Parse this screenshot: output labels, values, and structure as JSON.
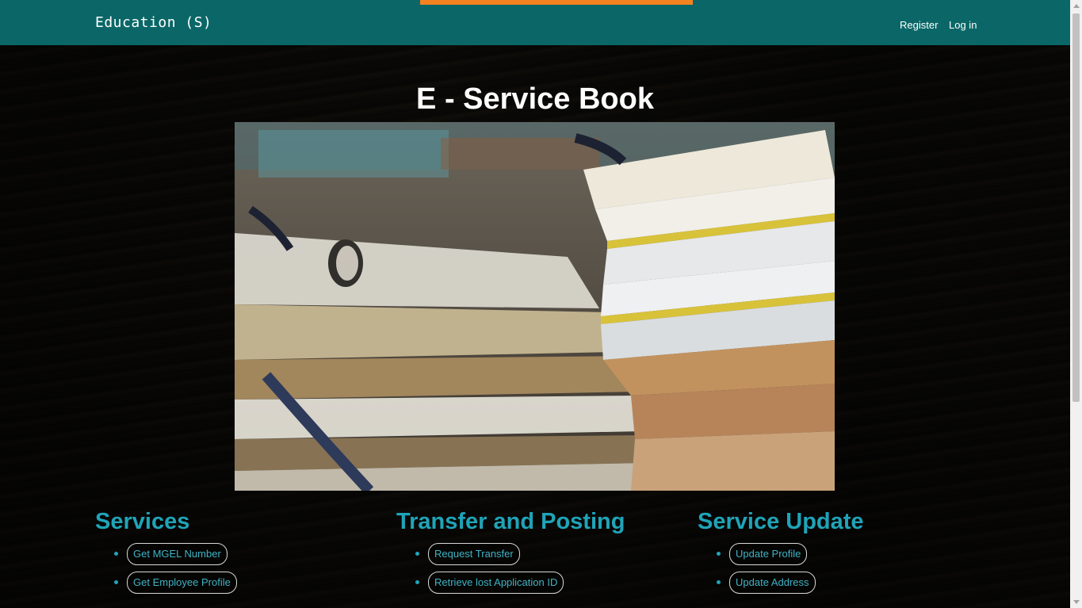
{
  "navbar": {
    "brand": "Education (S)",
    "register": "Register",
    "login": "Log in"
  },
  "page": {
    "title": "E - Service Book"
  },
  "hero_image": {
    "icon": "stacked-files-photo"
  },
  "sections": [
    {
      "heading": "Services",
      "items": [
        "Get MGEL Number",
        "Get Employee Profile"
      ]
    },
    {
      "heading": "Transfer and Posting",
      "items": [
        "Request Transfer",
        "Retrieve lost Application ID"
      ]
    },
    {
      "heading": "Service Update",
      "items": [
        "Update Profile",
        "Update Address"
      ]
    }
  ],
  "colors": {
    "navbar": "#0b6767",
    "accent": "#f58220",
    "heading": "#1fa4b8"
  }
}
